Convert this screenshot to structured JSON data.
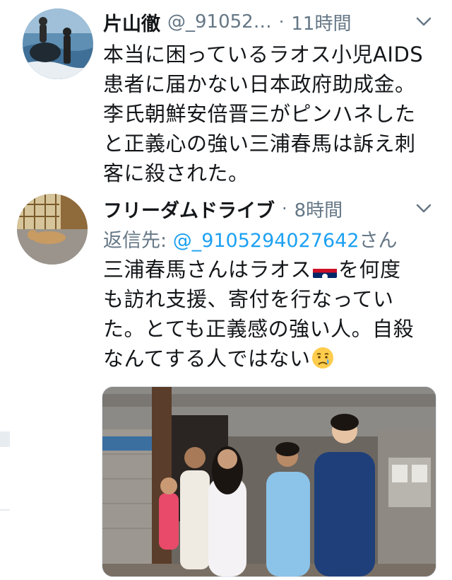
{
  "tweets": [
    {
      "author_name": "片山徹",
      "handle": "@_91052…",
      "separator": "·",
      "time": "11時間",
      "text": "本当に困っているラオス小児AIDS\n患者に届かない日本政府助成金。\n李氏朝鮮安倍晋三がピンハネした\nと正義心の強い三浦春馬は訴え刺\n客に殺された。"
    },
    {
      "author_name": "フリーダムドライブ",
      "separator": "·",
      "time": "8時間",
      "reply_prefix": "返信先: ",
      "reply_handle": "@_9105294027642",
      "reply_suffix": "さん",
      "text_part1": "三浦春馬さんはラオス",
      "text_part2": "を何度\nも訪れ支援、寄付を行なってい\nた。とても正義感の強い人。自殺\nなんてする人ではない",
      "flag_name": "laos-flag",
      "emoji_name": "crying-face-emoji"
    }
  ],
  "icons": {
    "more": "chevron-down-icon"
  },
  "colors": {
    "text": "#14171a",
    "secondary": "#657786",
    "link": "#1da1f2"
  }
}
